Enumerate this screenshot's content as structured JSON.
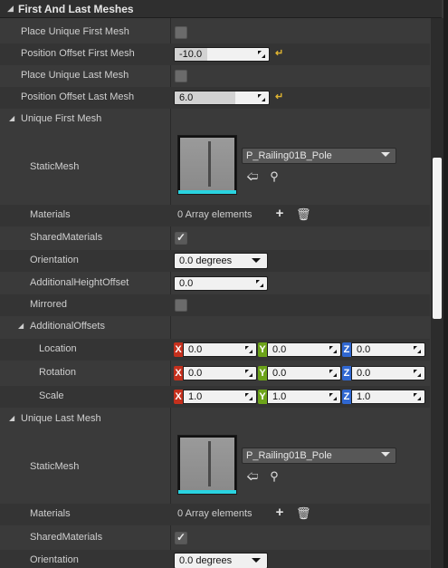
{
  "section": {
    "title": "First And Last Meshes"
  },
  "top_rows": [
    {
      "label": "Place Unique First Mesh",
      "checked": false
    },
    {
      "label": "Position Offset First Mesh",
      "value": "-10.0",
      "fill": 0.35
    },
    {
      "label": "Place Unique Last Mesh",
      "checked": false
    },
    {
      "label": "Position Offset Last Mesh",
      "value": "6.0",
      "fill": 0.7
    }
  ],
  "first_mesh": {
    "title": "Unique First Mesh",
    "static_mesh_label": "StaticMesh",
    "asset_name": "P_Railing01B_Pole",
    "materials_label": "Materials",
    "materials_value": "0 Array elements",
    "shared_materials_label": "SharedMaterials",
    "shared_materials_checked": true,
    "orientation_label": "Orientation",
    "orientation_value": "0.0 degrees",
    "height_label": "AdditionalHeightOffset",
    "height_value": "0.0",
    "mirrored_label": "Mirrored",
    "mirrored_checked": false,
    "offsets_label": "AdditionalOffsets",
    "location_label": "Location",
    "rotation_label": "Rotation",
    "scale_label": "Scale",
    "location": {
      "x": "0.0",
      "y": "0.0",
      "z": "0.0"
    },
    "rotation": {
      "x": "0.0",
      "y": "0.0",
      "z": "0.0"
    },
    "scale": {
      "x": "1.0",
      "y": "1.0",
      "z": "1.0"
    },
    "axis": {
      "x": "X",
      "y": "Y",
      "z": "Z"
    }
  },
  "last_mesh": {
    "title": "Unique Last Mesh",
    "static_mesh_label": "StaticMesh",
    "asset_name": "P_Railing01B_Pole",
    "materials_label": "Materials",
    "materials_value": "0 Array elements",
    "shared_materials_label": "SharedMaterials",
    "shared_materials_checked": true,
    "orientation_label": "Orientation",
    "orientation_value": "0.0 degrees"
  },
  "colors": {
    "axis_x": "#c5301d",
    "axis_y": "#6ca319",
    "axis_z": "#2f67d1",
    "reset": "#e0b431",
    "thumb_underline": "#2ad3e0"
  }
}
